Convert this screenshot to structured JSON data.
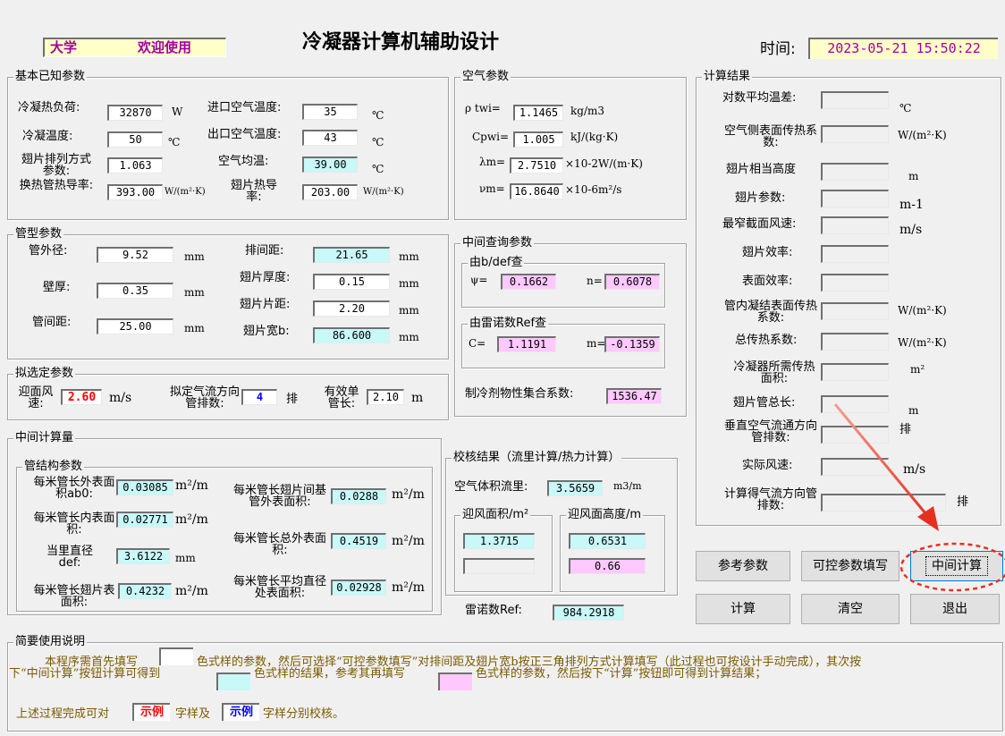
{
  "header": {
    "banner_a": "大学",
    "banner_b": "欢迎使用",
    "title": "冷凝器计算机辅助设计",
    "time_label": "时间:",
    "time_value": "2023-05-21 15:50:22"
  },
  "basic": {
    "title": "基本已知参数",
    "load_label": "冷凝热负荷:",
    "load_value": "32870",
    "load_unit": "W",
    "cond_temp_label": "冷凝温度:",
    "cond_temp_value": "50",
    "cond_temp_unit": "℃",
    "fin_arr_label": "翅片排列方式参数:",
    "fin_arr_value": "1.063",
    "tube_k_label": "换热管热导率:",
    "tube_k_value": "393.00",
    "tube_k_unit": "W/(m²·K)",
    "inlet_air_label": "进口空气温度:",
    "inlet_air_value": "35",
    "inlet_air_unit": "℃",
    "outlet_air_label": "出口空气温度:",
    "outlet_air_value": "43",
    "outlet_air_unit": "℃",
    "avg_air_label": "空气均温:",
    "avg_air_value": "39.00",
    "avg_air_unit": "℃",
    "fin_k_label": "翅片热导率:",
    "fin_k_value": "203.00",
    "fin_k_unit": "W/(m²·K)"
  },
  "air": {
    "title": "空气参数",
    "rho_label": "ρ twi=",
    "rho_value": "1.1465",
    "rho_unit": "kg/m3",
    "cp_label": "Cpwi=",
    "cp_value": "1.005",
    "cp_unit": "kJ/(kg·K)",
    "lambda_label": "λm=",
    "lambda_value": "2.7510",
    "lambda_unit": "×10-2W/(m·K)",
    "nu_label": "νm=",
    "nu_value": "16.8640",
    "nu_unit": "×10-6m²/s"
  },
  "tube": {
    "title": "管型参数",
    "od_label": "管外径:",
    "od_value": "9.52",
    "od_unit": "mm",
    "wall_label": "壁厚:",
    "wall_value": "0.35",
    "wall_unit": "mm",
    "pitch_label": "管间距:",
    "pitch_value": "25.00",
    "pitch_unit": "mm",
    "row_label": "排间距:",
    "row_value": "21.65",
    "row_unit": "mm",
    "fin_t_label": "翅片厚度:",
    "fin_t_value": "0.15",
    "fin_t_unit": "mm",
    "fin_p_label": "翅片片距:",
    "fin_p_value": "2.20",
    "fin_p_unit": "mm",
    "fin_w_label": "翅片宽b:",
    "fin_w_value": "86.600",
    "fin_w_unit": "mm"
  },
  "query": {
    "title": "中间查询参数",
    "bdef_title": "由b/def查",
    "psi_label": "ψ=",
    "psi_value": "0.1662",
    "n_label": "n=",
    "n_value": "0.6078",
    "ref_title": "由雷诺数Ref查",
    "c_label": "C=",
    "c_value": "1.1191",
    "m_label": "m=",
    "m_value": "-0.1359",
    "refrig_label": "制冷剂物性集合系数:",
    "refrig_value": "1536.47"
  },
  "proposed": {
    "title": "拟选定参数",
    "face_v_label": "迎面风速:",
    "face_v_value": "2.60",
    "face_v_unit": "m/s",
    "rows_label": "拟定气流方向管排数:",
    "rows_value": "4",
    "rows_unit": "排",
    "eff_len_label": "有效单管长:",
    "eff_len_value": "2.10",
    "eff_len_unit": "m"
  },
  "inter": {
    "title": "中间计算量",
    "struct_title": "管结构参数",
    "ab0_label": "每米管长外表面积ab0:",
    "ab0_value": "0.03085",
    "ab0_unit": "m²/m",
    "inner_label": "每米管长内表面积:",
    "inner_value": "0.02771",
    "inner_unit": "m²/m",
    "def_label": "当里直径def:",
    "def_value": "3.6122",
    "def_unit": "mm",
    "fin_area_label": "每米管长翅片表面积:",
    "fin_area_value": "0.4232",
    "fin_area_unit": "m²/m",
    "base_label": "每米管长翅片间基管外表面积:",
    "base_value": "0.0288",
    "base_unit": "m²/m",
    "total_label": "每米管长总外表面积:",
    "total_value": "0.4519",
    "total_unit": "m²/m",
    "avg_d_label": "每米管长平均直径处表面积:",
    "avg_d_value": "0.02928",
    "avg_d_unit": "m²/m"
  },
  "check": {
    "title": "校核结果（流里计算/热力计算）",
    "flow_label": "空气体积流里:",
    "flow_value": "3.5659",
    "flow_unit": "m3/m",
    "area_title": "迎风面积/m²",
    "area_value": "1.3715",
    "area_value2": "",
    "height_title": "迎风面高度/m",
    "height_value": "0.6531",
    "height_value2": "0.66",
    "re_label": "雷诺数Ref:",
    "re_value": "984.2918"
  },
  "results": {
    "title": "计算结果",
    "lmtd_label": "对数平均温差:",
    "lmtd_unit": "℃",
    "air_htc_label": "空气侧表面传热系数:",
    "air_htc_unit": "W/(m²·K)",
    "fin_h_label": "翅片相当高度",
    "fin_h_unit": "m",
    "fin_param_label": "翅片参数:",
    "fin_param_unit": "m-1",
    "max_v_label": "最窄截面风速:",
    "max_v_unit": "m/s",
    "fin_eff_label": "翅片效率:",
    "surf_eff_label": "表面效率:",
    "cond_htc_label": "管内凝结表面传热系数:",
    "cond_htc_unit": "W/(m²·K)",
    "total_k_label": "总传热系数:",
    "total_k_unit": "W/(m²·K)",
    "area_req_label": "冷凝器所需传热面积:",
    "area_req_unit": "m²",
    "fin_len_label": "翅片管总长:",
    "fin_len_unit": "m",
    "vert_rows_label": "垂直空气流通方向管排数:",
    "vert_rows_unit": "排",
    "actual_v_label": "实际风速:",
    "actual_v_unit": "m/s",
    "calc_rows_label": "计算得气流方向管排数:",
    "calc_rows_unit": "排"
  },
  "buttons": {
    "ref": "参考参数",
    "ctrl": "可控参数填写",
    "mid": "中间计算",
    "calc": "计算",
    "clear": "清空",
    "exit": "退出"
  },
  "help": {
    "title": "简要使用说明",
    "line1a": "本程序需首先填写",
    "line1b": "色式样的参数，然后可选择“可控参数填写”对排间距及翅片宽b按正三角排列方式计算填写（此过程也可按设计手动完成），其次按",
    "line2a": "下“中间计算”按钮计算可得到",
    "line2b": "色式样的结果，参考其再填写",
    "line2c": "色式样的参数，然后按下“计算”按钮即可得到计算结果；",
    "line3a": "上述过程完成可对",
    "sample": "示例",
    "line3b": "字样及",
    "line3c": "字样分别校核。"
  },
  "colors": {
    "cyan": "#c8f8f8",
    "pink": "#ffc8ff",
    "banner": "#ffffc8",
    "red_value": "#ff0000",
    "blue_value": "#0000ff",
    "arrow": "#e53020"
  }
}
